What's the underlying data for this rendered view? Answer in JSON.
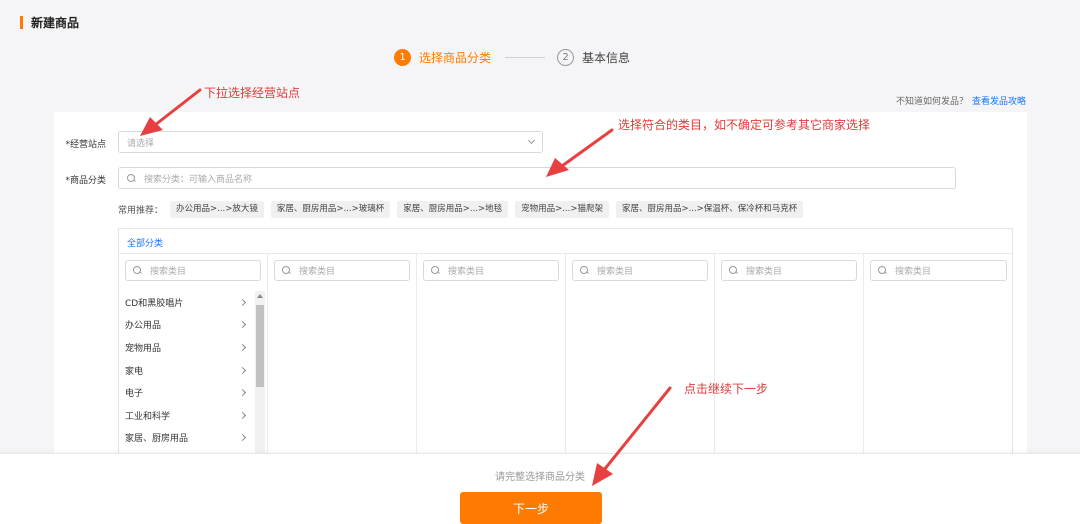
{
  "page": {
    "title": "新建商品"
  },
  "steps": [
    {
      "num": "1",
      "label": "选择商品分类",
      "state": "active"
    },
    {
      "num": "2",
      "label": "基本信息",
      "state": "inactive"
    }
  ],
  "help": {
    "text": "不知道如何发品？",
    "link": "查看发品攻略"
  },
  "form": {
    "site": {
      "label": "*经营站点",
      "placeholder": "请选择"
    },
    "category": {
      "label": "*商品分类",
      "placeholder": "搜索分类：可输入商品名称"
    },
    "recommend": {
      "label": "常用推荐：",
      "tags": [
        "办公用品>...>放大镜",
        "家居、厨房用品>...>玻璃杯",
        "家居、厨房用品>...>地毯",
        "宠物用品>...>猫爬架",
        "家居、厨房用品>...>保温杯、保冷杯和马克杯"
      ]
    }
  },
  "category_panel": {
    "tab": "全部分类",
    "search_placeholder": "搜索类目",
    "first_column": [
      "CD和黑胶唱片",
      "办公用品",
      "宠物用品",
      "家电",
      "电子",
      "工业和科学",
      "家居、厨房用品"
    ]
  },
  "annotations": {
    "site_hint": "下拉选择经营站点",
    "category_hint": "选择符合的类目，如不确定可参考其它商家选择",
    "next_hint": "点击继续下一步"
  },
  "footer": {
    "hint": "请完整选择商品分类",
    "next_button": "下一步"
  },
  "colors": {
    "accent": "#ff7a00",
    "link": "#1677ff",
    "annotation": "#e03a3a"
  }
}
